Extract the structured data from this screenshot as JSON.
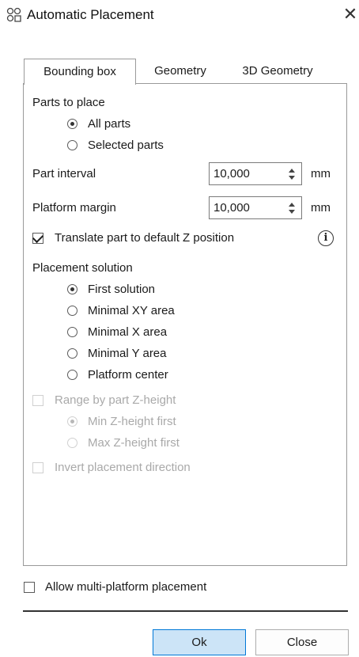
{
  "window": {
    "title": "Automatic Placement",
    "close_icon": "close-icon",
    "app_icon": "parts-icon"
  },
  "tabs": [
    {
      "label": "Bounding box",
      "active": true
    },
    {
      "label": "Geometry",
      "active": false
    },
    {
      "label": "3D Geometry",
      "active": false
    }
  ],
  "parts_to_place": {
    "heading": "Parts to place",
    "options": [
      {
        "label": "All parts",
        "checked": true
      },
      {
        "label": "Selected parts",
        "checked": false
      }
    ]
  },
  "part_interval": {
    "label": "Part interval",
    "value": "10,000",
    "unit": "mm"
  },
  "platform_margin": {
    "label": "Platform margin",
    "value": "10,000",
    "unit": "mm"
  },
  "translate_z": {
    "label": "Translate part to default Z position",
    "checked": true,
    "info_icon": "info-icon"
  },
  "placement_solution": {
    "heading": "Placement solution",
    "options": [
      {
        "label": "First solution",
        "checked": true
      },
      {
        "label": "Minimal XY area",
        "checked": false
      },
      {
        "label": "Minimal X area",
        "checked": false
      },
      {
        "label": "Minimal Y area",
        "checked": false
      },
      {
        "label": "Platform center",
        "checked": false
      }
    ]
  },
  "range_by_z": {
    "label": "Range by part Z-height",
    "enabled": false,
    "options": [
      {
        "label": "Min Z-height first",
        "checked": true
      },
      {
        "label": "Max Z-height first",
        "checked": false
      }
    ]
  },
  "invert_direction": {
    "label": "Invert placement direction",
    "enabled": false,
    "checked": false
  },
  "multi_platform": {
    "label": "Allow multi-platform placement",
    "checked": false
  },
  "buttons": {
    "ok": "Ok",
    "close": "Close"
  }
}
